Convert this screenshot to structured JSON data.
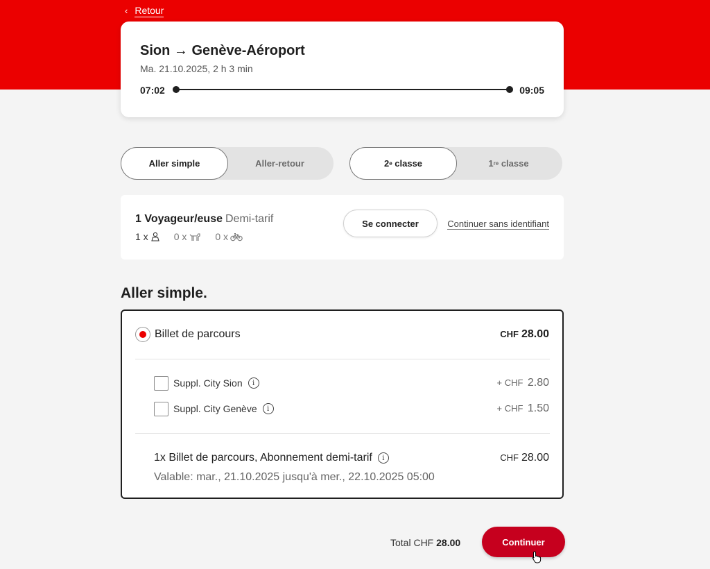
{
  "nav": {
    "back_label": "Retour"
  },
  "trip": {
    "origin": "Sion",
    "destination": "Genève-Aéroport",
    "arrow": "→",
    "subtitle": "Ma. 21.10.2025, 2 h 3 min",
    "departure": "07:02",
    "arrival": "09:05"
  },
  "journey_type": {
    "options": [
      "Aller simple",
      "Aller-retour"
    ],
    "selected": "Aller simple"
  },
  "class_select": {
    "options": [
      {
        "num": "2",
        "sup": "e",
        "label": "classe"
      },
      {
        "num": "1",
        "sup": "re",
        "label": "classe"
      }
    ],
    "selected_index": 0
  },
  "travellers": {
    "title": "1 Voyageur/euse",
    "discount": "Demi-tarif",
    "counts": [
      {
        "value": "1 x",
        "icon": "person-icon"
      },
      {
        "value": "0 x",
        "icon": "dog-icon"
      },
      {
        "value": "0 x",
        "icon": "bicycle-icon"
      }
    ],
    "login_label": "Se connecter",
    "guest_label": "Continuer sans identifiant"
  },
  "offer_section": {
    "title": "Aller simple.",
    "ticket": {
      "name": "Billet de parcours",
      "currency": "CHF",
      "price": "28.00",
      "selected": true
    },
    "supplements": [
      {
        "label": "Suppl. City Sion",
        "prefix": "+ CHF",
        "price": "2.80",
        "checked": false
      },
      {
        "label": "Suppl. City Genève",
        "prefix": "+ CHF",
        "price": "1.50",
        "checked": false
      }
    ],
    "summary": {
      "line": "1x Billet de parcours, Abonnement demi-tarif",
      "currency": "CHF",
      "price": "28.00",
      "validity": "Valable: mar., 21.10.2025 jusqu'à mer., 22.10.2025 05:00"
    }
  },
  "footer": {
    "total_label": "Total CHF",
    "total_value": "28.00",
    "continue_label": "Continuer"
  },
  "colors": {
    "brand_red": "#eb0000",
    "button_red": "#c6001e"
  }
}
